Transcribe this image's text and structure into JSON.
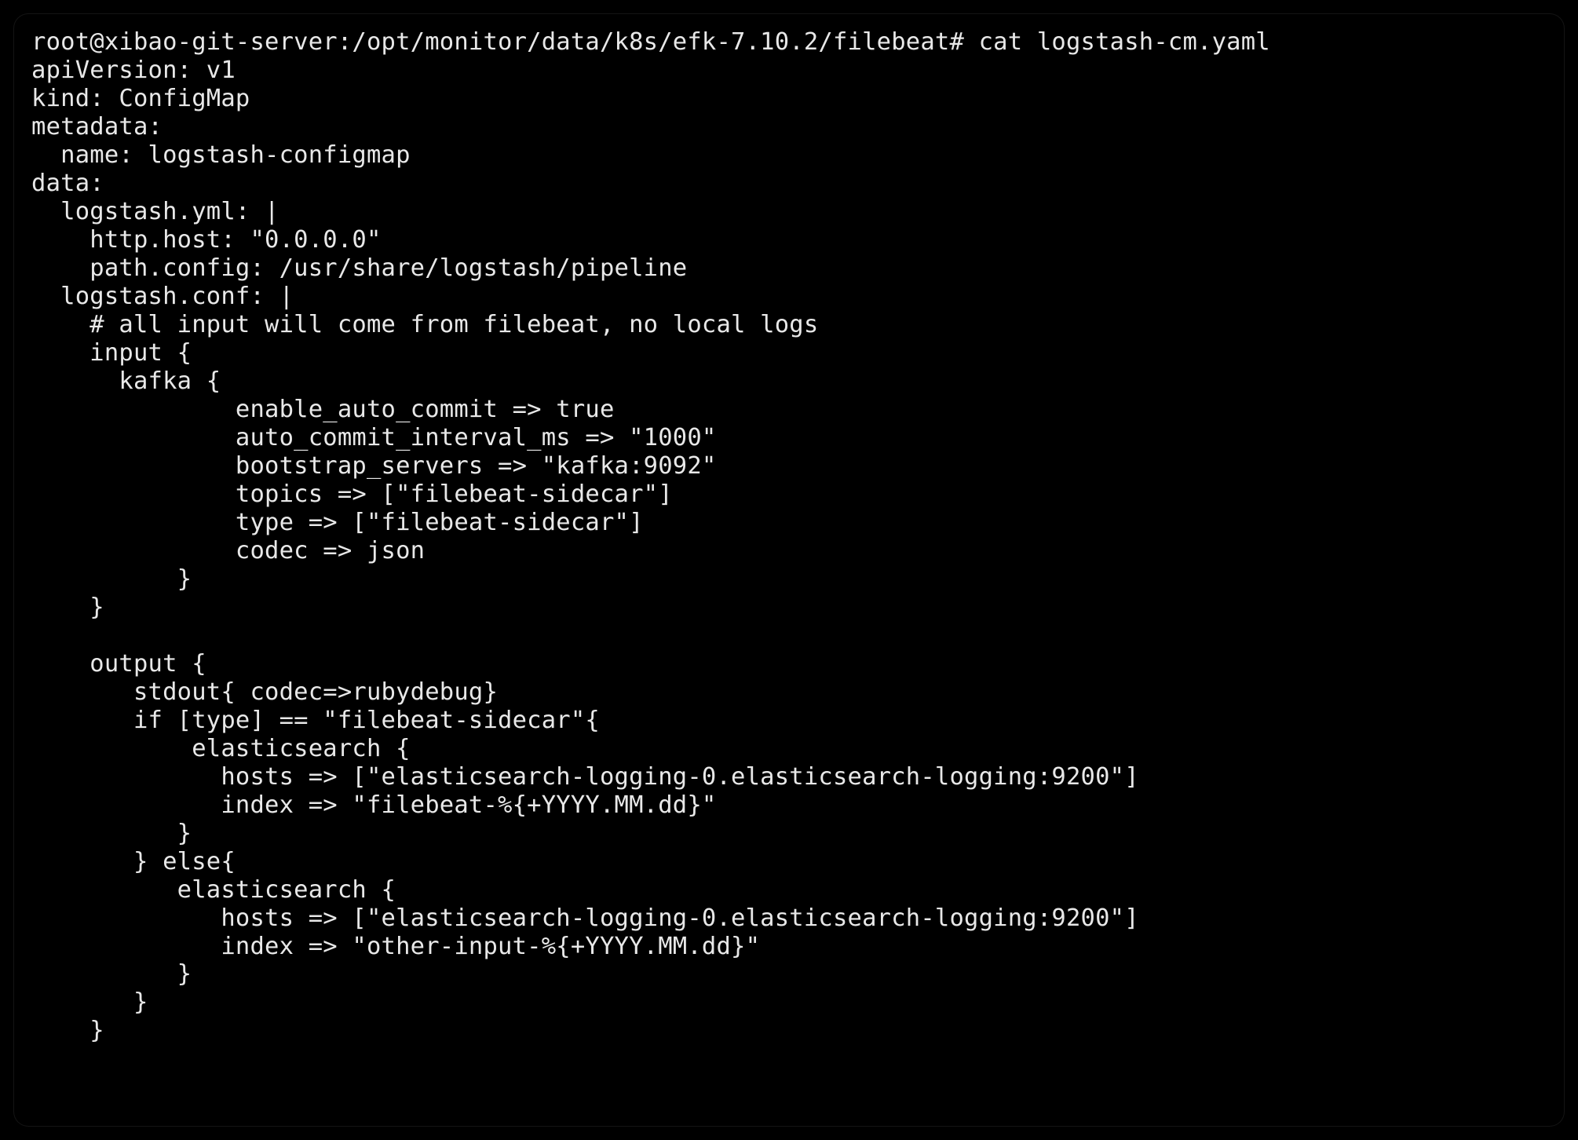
{
  "terminal": {
    "prompt": "root@xibao-git-server:/opt/monitor/data/k8s/efk-7.10.2/filebeat# ",
    "command": "cat logstash-cm.yaml",
    "lines": [
      "apiVersion: v1",
      "kind: ConfigMap",
      "metadata:",
      "  name: logstash-configmap",
      "data:",
      "  logstash.yml: |",
      "    http.host: \"0.0.0.0\"",
      "    path.config: /usr/share/logstash/pipeline",
      "  logstash.conf: |",
      "    # all input will come from filebeat, no local logs",
      "    input {",
      "      kafka {",
      "              enable_auto_commit => true",
      "              auto_commit_interval_ms => \"1000\"",
      "              bootstrap_servers => \"kafka:9092\"",
      "              topics => [\"filebeat-sidecar\"]",
      "              type => [\"filebeat-sidecar\"]",
      "              codec => json",
      "          }",
      "    }",
      "",
      "    output {",
      "       stdout{ codec=>rubydebug}",
      "       if [type] == \"filebeat-sidecar\"{",
      "           elasticsearch {",
      "             hosts => [\"elasticsearch-logging-0.elasticsearch-logging:9200\"]",
      "             index => \"filebeat-%{+YYYY.MM.dd}\"",
      "          }",
      "       } else{",
      "          elasticsearch {",
      "             hosts => [\"elasticsearch-logging-0.elasticsearch-logging:9200\"]",
      "             index => \"other-input-%{+YYYY.MM.dd}\"",
      "          }",
      "       }",
      "    }"
    ]
  }
}
